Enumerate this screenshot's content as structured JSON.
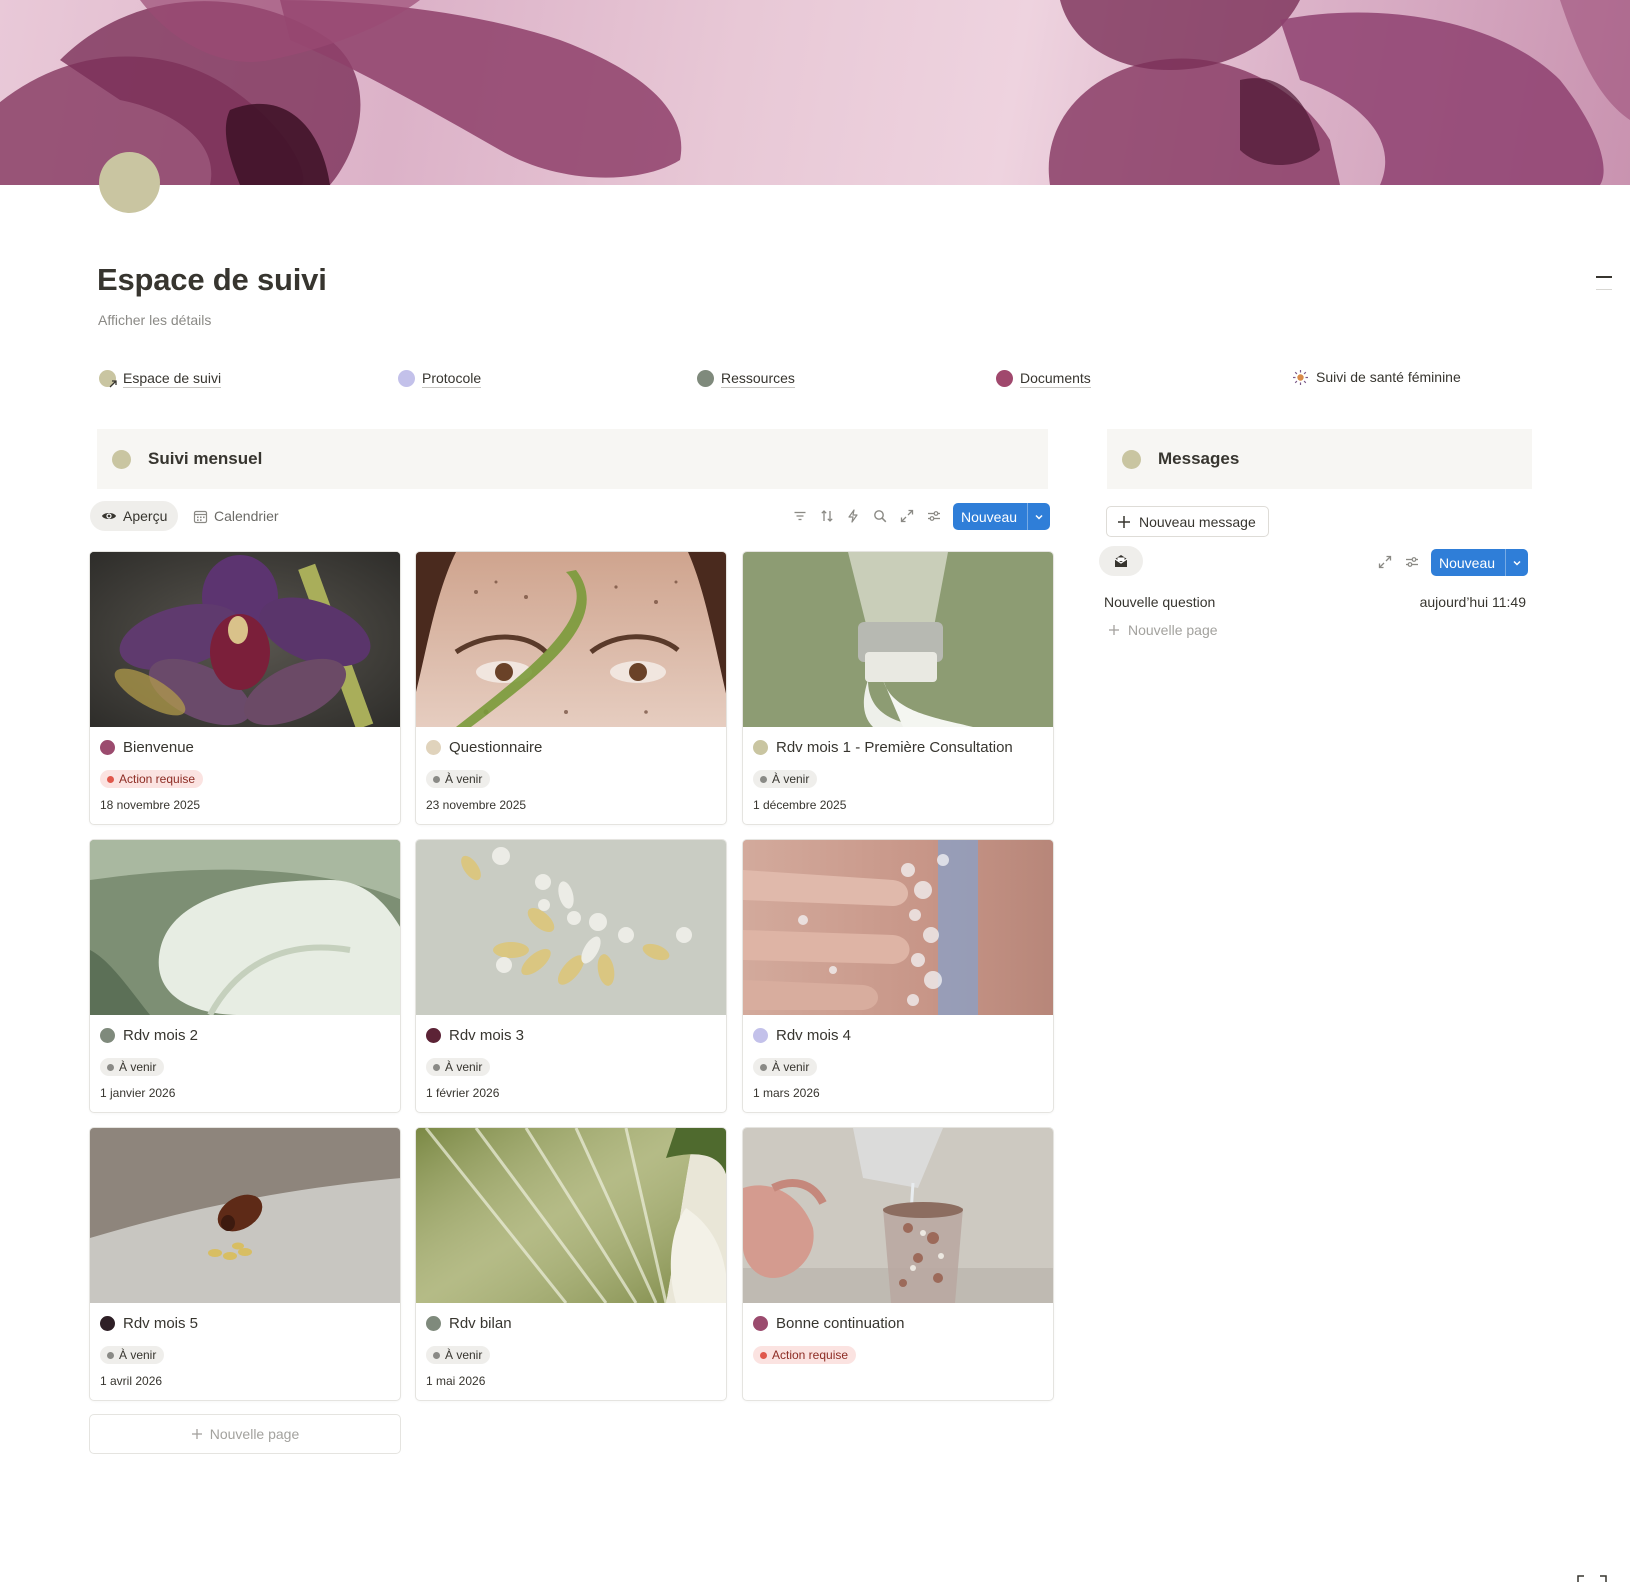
{
  "page": {
    "title": "Espace de suivi",
    "details_link": "Afficher les détails",
    "icon_color": "#c9c5a1"
  },
  "nav": [
    {
      "label": "Espace de suivi",
      "dot_color": "#c9c5a1",
      "linked": true
    },
    {
      "label": "Protocole",
      "dot_color": "#c3c1ea",
      "linked": true
    },
    {
      "label": "Ressources",
      "dot_color": "#7f8a7c",
      "linked": true
    },
    {
      "label": "Documents",
      "dot_color": "#a0486d",
      "linked": true
    },
    {
      "label": "Suivi de santé féminine",
      "icon": "sun-icon",
      "linked": false
    }
  ],
  "suivi": {
    "header": "Suivi mensuel",
    "views": [
      {
        "label": "Aperçu",
        "icon": "eye-icon",
        "active": true
      },
      {
        "label": "Calendrier",
        "icon": "calendar-icon",
        "active": false
      }
    ],
    "toolbar_icons": [
      "filter-icon",
      "sort-icon",
      "automation-icon",
      "search-icon",
      "expand-icon",
      "settings-icon"
    ],
    "new_button": "Nouveau",
    "new_page": "Nouvelle page",
    "cards": [
      {
        "name": "Bienvenue",
        "dot_color": "#9b4b6e",
        "tag": "Action requise",
        "tag_type": "action",
        "date": "18 novembre 2025",
        "image": "purple orchid"
      },
      {
        "name": "Questionnaire",
        "dot_color": "#e0d3bc",
        "tag": "À venir",
        "tag_type": "venir",
        "date": "23 novembre 2025",
        "image": "freckled eyes"
      },
      {
        "name": "Rdv mois 1 - Première Consultation",
        "dot_color": "#c9c5a1",
        "tag": "À venir",
        "tag_type": "venir",
        "date": "1 décembre 2025",
        "image": "cream tube"
      },
      {
        "name": "Rdv mois 2",
        "dot_color": "#7f8a7c",
        "tag": "À venir",
        "tag_type": "venir",
        "date": "1 janvier 2026",
        "image": "calla lily"
      },
      {
        "name": "Rdv mois 3",
        "dot_color": "#5c2336",
        "tag": "À venir",
        "tag_type": "venir",
        "date": "1 février 2026",
        "image": "supplements"
      },
      {
        "name": "Rdv mois 4",
        "dot_color": "#c3c1ea",
        "tag": "À venir",
        "tag_type": "venir",
        "date": "1 mars 2026",
        "image": "soapy fingers"
      },
      {
        "name": "Rdv mois 5",
        "dot_color": "#2e1f26",
        "tag": "À venir",
        "tag_type": "venir",
        "date": "1 avril 2026",
        "image": "amber bottle"
      },
      {
        "name": "Rdv bilan",
        "dot_color": "#7f8a7c",
        "tag": "À venir",
        "tag_type": "venir",
        "date": "1 mai 2026",
        "image": "leaf"
      },
      {
        "name": "Bonne continuation",
        "dot_color": "#9b4b6e",
        "tag": "Action requise",
        "tag_type": "action",
        "date": "",
        "image": "herbal tea"
      }
    ]
  },
  "messages": {
    "header": "Messages",
    "new_message": "Nouveau message",
    "new_button": "Nouveau",
    "rows": [
      {
        "title": "Nouvelle question",
        "time": "aujourd’hui 11:49"
      }
    ],
    "new_page": "Nouvelle page"
  },
  "colors": {
    "accent": "#2f7ed8",
    "panel_bg": "#f7f6f3",
    "action_tag_bg": "#fbe3e1",
    "venir_tag_bg": "#efeeeb"
  }
}
